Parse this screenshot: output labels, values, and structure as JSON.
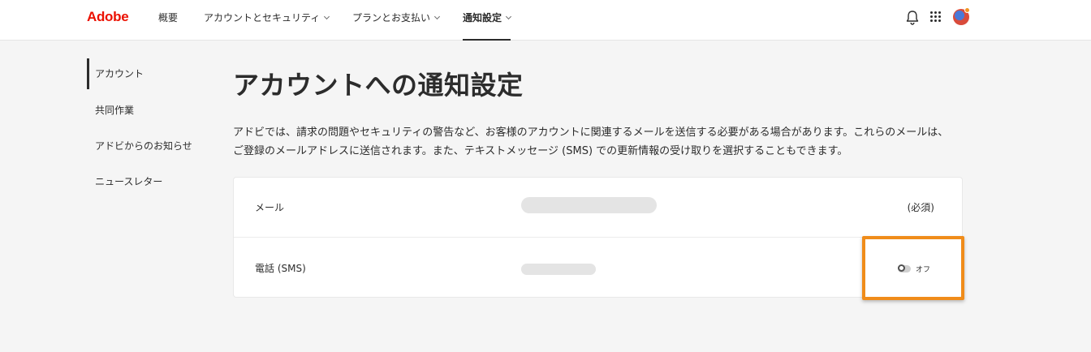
{
  "header": {
    "logo": "Adobe",
    "nav": [
      {
        "label": "概要"
      },
      {
        "label": "アカウントとセキュリティ"
      },
      {
        "label": "プランとお支払い"
      },
      {
        "label": "通知設定"
      }
    ],
    "icons": [
      "bell-icon",
      "apps-grid-icon",
      "avatar"
    ]
  },
  "sidebar": {
    "items": [
      {
        "label": "アカウント",
        "active": true
      },
      {
        "label": "共同作業"
      },
      {
        "label": "アドビからのお知らせ"
      },
      {
        "label": "ニュースレター"
      }
    ]
  },
  "main": {
    "title": "アカウントへの通知設定",
    "description_line1": "アドビでは、請求の問題やセキュリティの警告など、お客様のアカウントに関連するメールを送信する必要がある場合があります。これらのメールは、",
    "description_line2": "ご登録のメールアドレスに送信されます。また、テキストメッセージ (SMS) での更新情報の受け取りを選択することもできます。",
    "rows": [
      {
        "label": "メール",
        "status": "(必須)"
      },
      {
        "label": "電話 (SMS)",
        "toggle_label": "オフ",
        "toggle_on": false
      }
    ]
  },
  "colors": {
    "brand": "#eb1000",
    "highlight": "#f08c1a"
  }
}
